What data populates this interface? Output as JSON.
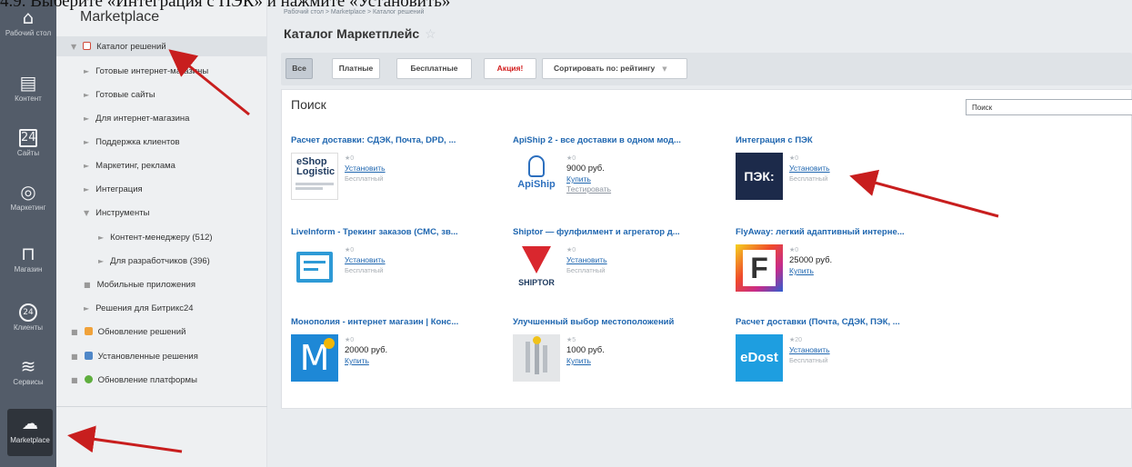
{
  "caption": "4.9. Выберите «Интеграция с ПЭК» и нажмите «Установить»",
  "leftbar": {
    "items": [
      {
        "icon": "house-icon",
        "label": "Рабочий стол"
      },
      {
        "icon": "document-icon",
        "label": "Контент"
      },
      {
        "icon": "calendar-24-icon",
        "label": "Сайты"
      },
      {
        "icon": "target-icon",
        "label": "Маркетинг"
      },
      {
        "icon": "cart-icon",
        "label": "Магазин"
      },
      {
        "icon": "clients-24-icon",
        "label": "Клиенты"
      },
      {
        "icon": "layers-icon",
        "label": "Сервисы"
      },
      {
        "icon": "cloud-download-icon",
        "label": "Marketplace"
      }
    ]
  },
  "sidebar": {
    "title": "Marketplace",
    "items": [
      {
        "label": "Каталог решений"
      },
      {
        "label": "Готовые интернет-магазины"
      },
      {
        "label": "Готовые сайты"
      },
      {
        "label": "Для интернет-магазина"
      },
      {
        "label": "Поддержка клиентов"
      },
      {
        "label": "Маркетинг, реклама"
      },
      {
        "label": "Интеграция"
      },
      {
        "label": "Инструменты"
      },
      {
        "label": "Контент-менеджеру (512)"
      },
      {
        "label": "Для разработчиков (396)"
      },
      {
        "label": "Мобильные приложения"
      },
      {
        "label": "Решения для Битрикс24"
      },
      {
        "label": "Обновление решений"
      },
      {
        "label": "Установленные решения"
      },
      {
        "label": "Обновление платформы"
      }
    ]
  },
  "main": {
    "breadcrumbs": "Рабочий стол  >  Marketplace  >  Каталог решений",
    "title": "Каталог Маркетплейс",
    "filters": {
      "all": "Все",
      "paid": "Платные",
      "free": "Бесплатные",
      "promo": "Акция!",
      "sort": "Сортировать по: рейтингу"
    },
    "search_heading": "Поиск",
    "search_value": "Поиск"
  },
  "cards": [
    {
      "title": "Расчет доставки: СДЭК, Почта, DPD, ...",
      "rating": "★0",
      "action": "Установить",
      "sub": "Бесплатный",
      "logo": "eShop Logistic"
    },
    {
      "title": "ApiShip 2 - все доставки в одном мод...",
      "rating": "★0",
      "price": "9000 руб.",
      "action": "Купить",
      "test": "Тестировать",
      "logo": "ApiShip"
    },
    {
      "title": "Интеграция с ПЭК",
      "rating": "★0",
      "action": "Установить",
      "sub": "Бесплатный",
      "logo": "ПЭК:"
    },
    {
      "title": "LiveInform - Трекинг заказов (СМС, зв...",
      "rating": "★0",
      "action": "Установить",
      "sub": "Бесплатный",
      "logo": "liveinform"
    },
    {
      "title": "Shiptor — фулфилмент и агрегатор д...",
      "rating": "★0",
      "action": "Установить",
      "sub": "Бесплатный",
      "logo": "SHIPTOR"
    },
    {
      "title": "FlyAway: легкий адаптивный интерне...",
      "rating": "★0",
      "price": "25000 руб.",
      "action": "Купить",
      "logo": "F"
    },
    {
      "title": "Монополия - интернет магазин | Конс...",
      "rating": "★0",
      "price": "20000 руб.",
      "action": "Купить",
      "logo": "M"
    },
    {
      "title": "Улучшенный выбор местоположений",
      "rating": "★5",
      "price": "1000 руб.",
      "action": "Купить",
      "logo": "location"
    },
    {
      "title": "Расчет доставки (Почта, СДЭК, ПЭК, ...",
      "rating": "★20",
      "action": "Установить",
      "sub": "Бесплатный",
      "logo": "eDost"
    }
  ],
  "colors": {
    "accent_link": "#2067b0",
    "promo": "#d21c1c",
    "arrow": "#c81e1e",
    "leftbar": "#535c69"
  }
}
